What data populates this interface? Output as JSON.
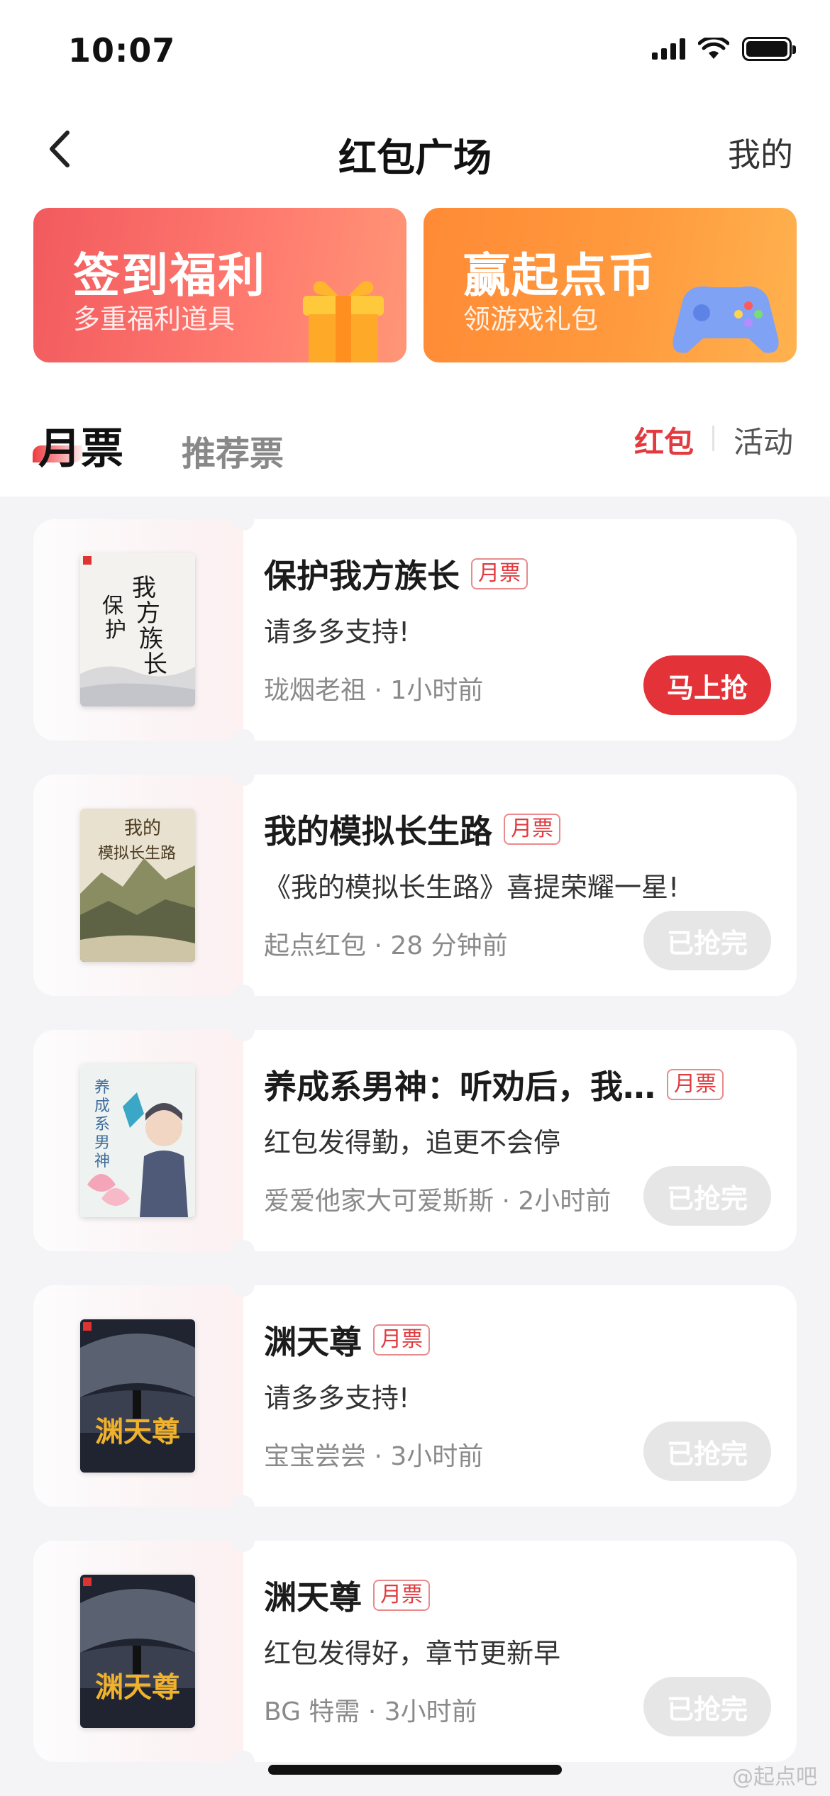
{
  "status_bar": {
    "time": "10:07"
  },
  "nav": {
    "title": "红包广场",
    "right_label": "我的"
  },
  "banners": [
    {
      "title": "签到福利",
      "subtitle": "多重福利道具",
      "color": "#f25a5e"
    },
    {
      "title": "赢起点币",
      "subtitle": "领游戏礼包",
      "color": "#ff8a35"
    }
  ],
  "tabs": {
    "active": "月票",
    "inactive": "推荐票"
  },
  "filters": {
    "red": "红包",
    "activity": "活动"
  },
  "accent_color": "#e43239",
  "cards": [
    {
      "title": "保护我方族长",
      "tag": "月票",
      "message": "请多多支持!",
      "meta": "珑烟老祖 · 1小时前",
      "button": "马上抢",
      "button_state": "active",
      "cover_text": "我方族长"
    },
    {
      "title": "我的模拟长生路",
      "tag": "月票",
      "message": "《我的模拟长生路》喜提荣耀一星!",
      "meta": "起点红包 · 28 分钟前",
      "button": "已抢完",
      "button_state": "done",
      "cover_text": "我的模拟长生路"
    },
    {
      "title": "养成系男神：听劝后，我…",
      "tag": "月票",
      "message": "红包发得勤，追更不会停",
      "meta": "爱爱他家大可爱斯斯 · 2小时前",
      "button": "已抢完",
      "button_state": "done",
      "cover_text": "养成系男神"
    },
    {
      "title": "渊天尊",
      "tag": "月票",
      "message": "请多多支持!",
      "meta": "宝宝尝尝 · 3小时前",
      "button": "已抢完",
      "button_state": "done",
      "cover_text": "渊天尊"
    },
    {
      "title": "渊天尊",
      "tag": "月票",
      "message": "红包发得好，章节更新早",
      "meta": "BG 特需 · 3小时前",
      "button": "已抢完",
      "button_state": "done",
      "cover_text": "渊天尊"
    }
  ],
  "watermark": "@起点吧"
}
